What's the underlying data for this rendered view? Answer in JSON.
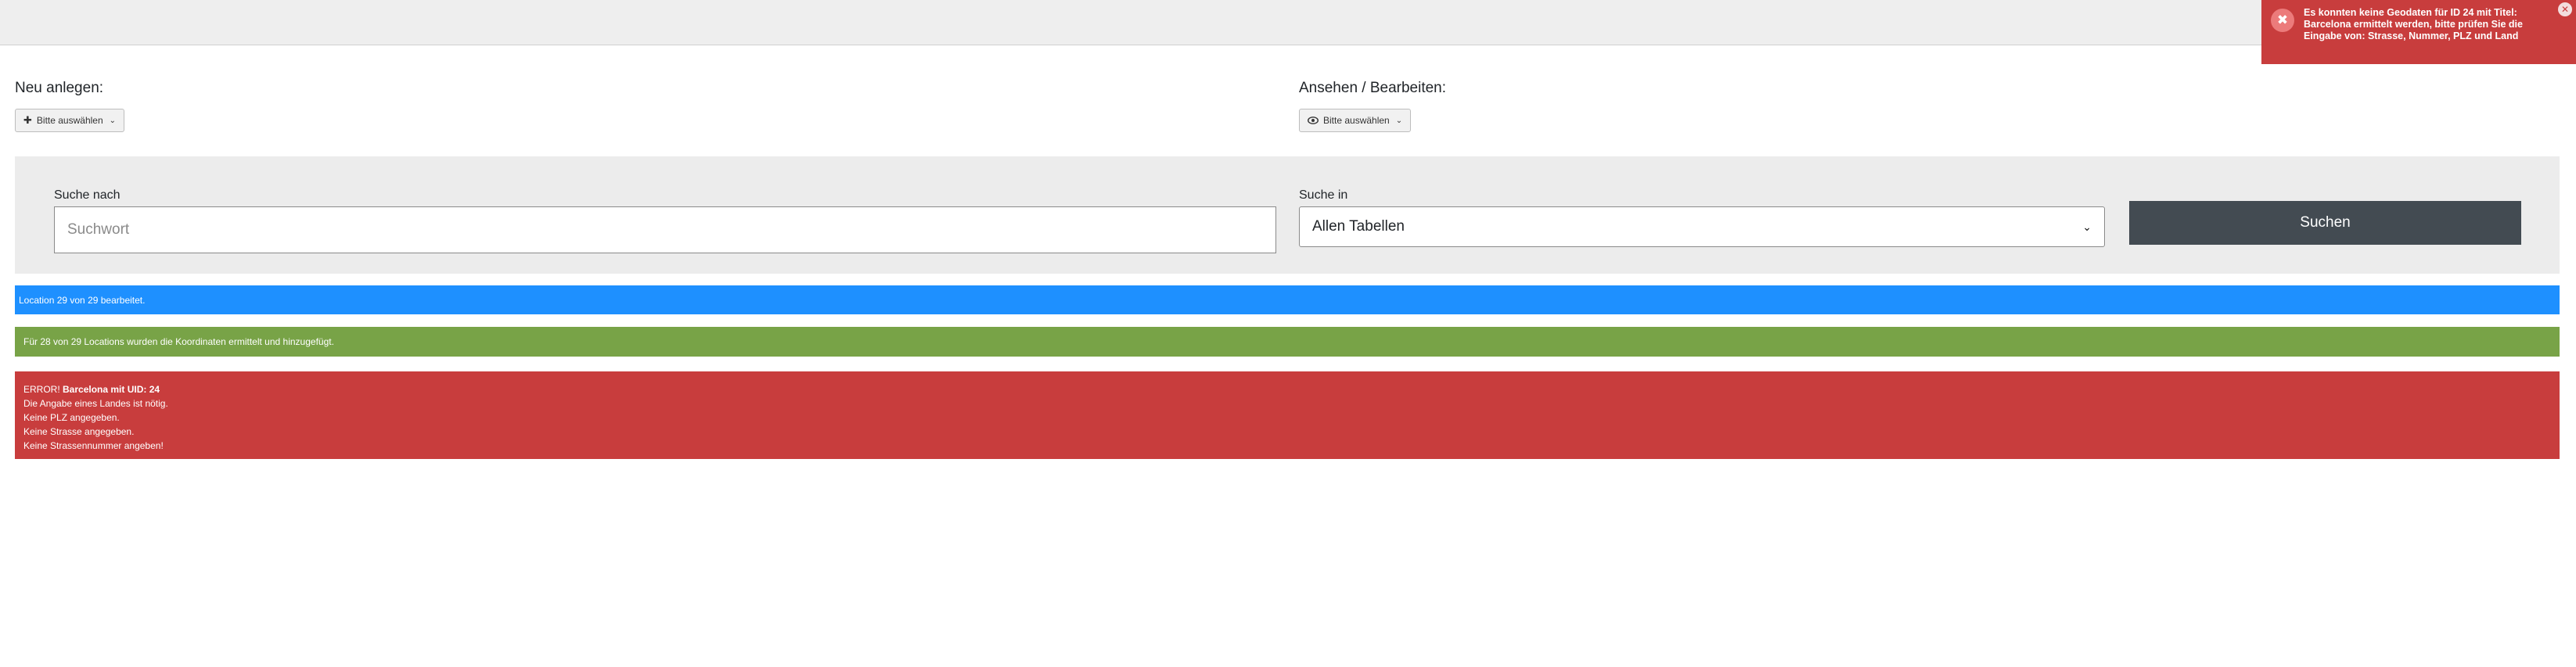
{
  "create": {
    "title": "Neu anlegen:",
    "dropdown_label": "Bitte auswählen",
    "icon": "plus-icon"
  },
  "view": {
    "title": "Ansehen / Bearbeiten:",
    "dropdown_label": "Bitte auswählen",
    "icon": "eye-icon"
  },
  "search": {
    "term_label": "Suche nach",
    "term_placeholder": "Suchwort",
    "term_value": "",
    "scope_label": "Suche in",
    "scope_value": "Allen Tabellen",
    "button_label": "Suchen"
  },
  "alerts": {
    "info": "Location 29 von 29 bearbeitet.",
    "success": "Für 28 von 29 Locations wurden die Koordinaten ermittelt und hinzugefügt.",
    "error": {
      "prefix": "ERROR!",
      "title": "Barcelona mit UID: 24",
      "lines": [
        "Die Angabe eines Landes ist nötig.",
        "Keine PLZ angegeben.",
        "Keine Strasse angegeben.",
        "Keine Strassennummer angeben!"
      ]
    }
  },
  "toast": {
    "message": "Es konnten keine Geodaten für ID 24 mit Titel: Barcelona ermittelt werden, bitte prüfen Sie die Eingabe von: Strasse, Nummer, PLZ und Land",
    "icon": "error-x-icon",
    "close_icon": "close-icon"
  },
  "colors": {
    "info": "#1e90ff",
    "success": "#78a347",
    "error": "#c83d3d",
    "search_button": "#434b52"
  }
}
